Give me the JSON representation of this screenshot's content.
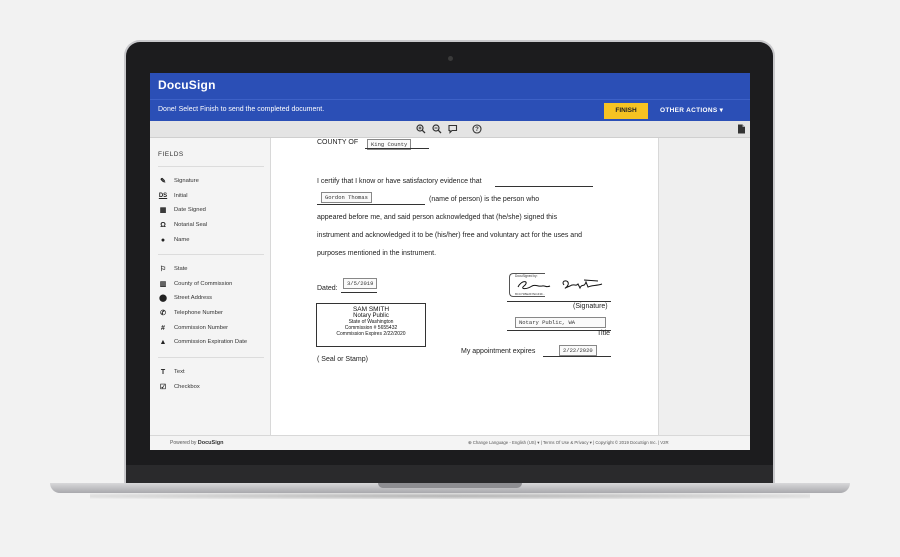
{
  "app": {
    "logo": "DocuSign"
  },
  "action_bar": {
    "message": "Done! Select Finish to send the completed document.",
    "finish_label": "FINISH",
    "other_actions_label": "OTHER ACTIONS ▾"
  },
  "toolbar": {
    "icons": [
      "zoom-in-icon",
      "zoom-out-icon",
      "comment-icon",
      "help-icon",
      "document-icon"
    ]
  },
  "sidebar": {
    "title": "FIELDS",
    "group1": [
      {
        "icon": "✎",
        "label": "Signature"
      },
      {
        "icon": "DS",
        "label": "Initial"
      },
      {
        "icon": "▦",
        "label": "Date Signed"
      },
      {
        "icon": "Ω",
        "label": "Notarial Seal"
      },
      {
        "icon": "●",
        "label": "Name"
      }
    ],
    "group2": [
      {
        "icon": "⚐",
        "label": "State"
      },
      {
        "icon": "▥",
        "label": "County of Commission"
      },
      {
        "icon": "⬤",
        "label": "Street Address"
      },
      {
        "icon": "✆",
        "label": "Telephone Number"
      },
      {
        "icon": "#",
        "label": "Commission Number"
      },
      {
        "icon": "▲",
        "label": "Commission Expiration Date"
      }
    ],
    "group3": [
      {
        "icon": "T",
        "label": "Text"
      },
      {
        "icon": "☑",
        "label": "Checkbox"
      }
    ]
  },
  "document": {
    "county_label": "COUNTY OF",
    "county_value": "King County",
    "certify_text": "I certify that I know or have satisfactory evidence that",
    "person_value": "Gordon Thomas",
    "name_of_person": "(name of person) is the person who",
    "line3": "appeared before me, and said person acknowledged that (he/she) signed this",
    "line4": "instrument and acknowledged it to be (his/her) free and voluntary act for the uses and",
    "line5": "purposes mentioned in the instrument.",
    "dated_label": "Dated:",
    "dated_value": "3/5/2019",
    "signature_caption": "(Signature)",
    "docusigned_by": "DocuSigned by:",
    "signature_id": "8CC71BE2F7EC43F...",
    "title_value": "Notary Public, WA",
    "title_caption": "Title",
    "appointment_label": "My appointment expires",
    "appointment_value": "2/22/2020",
    "seal_or_stamp": "( Seal or Stamp)",
    "seal": {
      "name": "SAM SMITH",
      "role": "Notary Public",
      "state": "State of Washington",
      "commission": "Commission # 5655432",
      "expires": "Commission Expires 2/22/2020"
    }
  },
  "footer": {
    "powered_by": "Powered by",
    "powered_brand": "DocuSign",
    "links": "⊕ Change Language - English (US) ▾   |   Terms Of Use & Privacy ▾   |   Copyright © 2019 DocuSign Inc. | V2R"
  }
}
